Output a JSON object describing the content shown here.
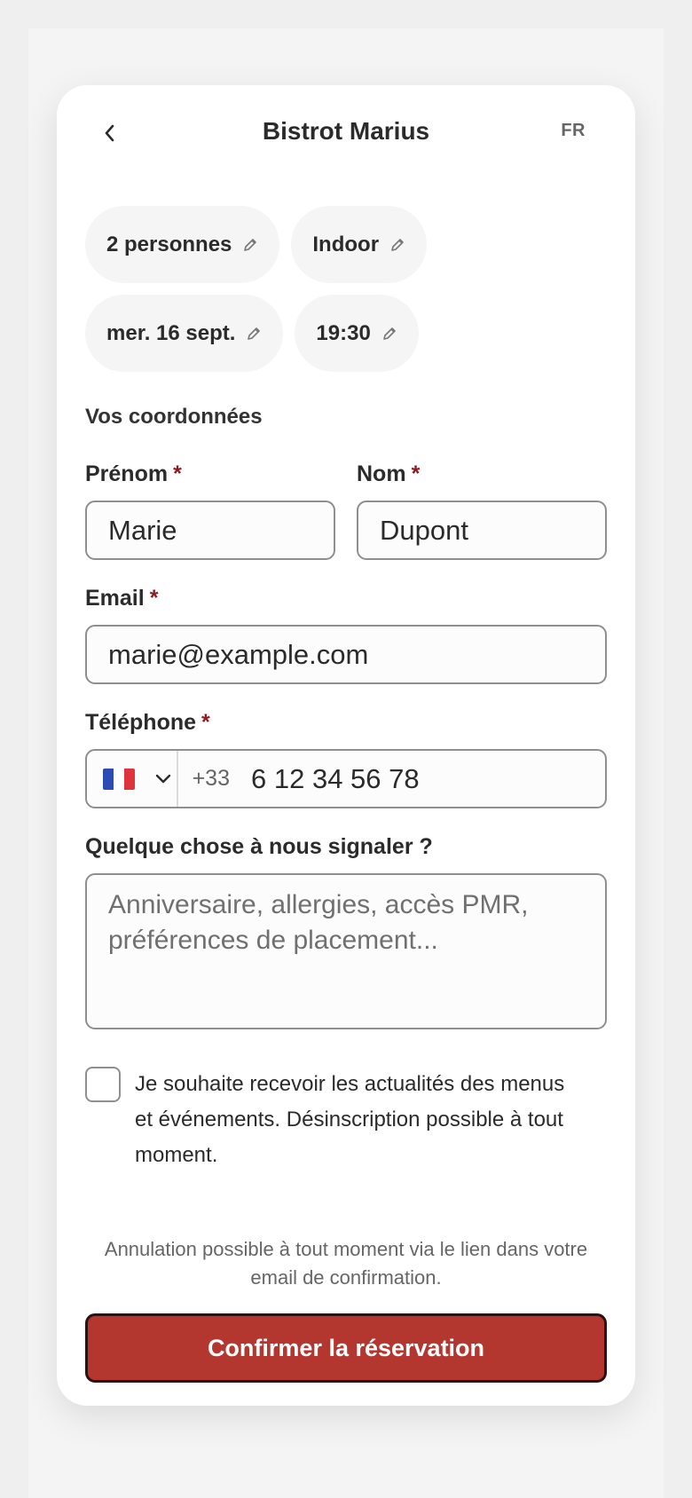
{
  "header": {
    "title": "Bistrot Marius",
    "lang": "FR"
  },
  "chips": [
    {
      "label": "2 personnes"
    },
    {
      "label": "Indoor"
    },
    {
      "label": "mer. 16 sept."
    },
    {
      "label": "19:30"
    }
  ],
  "form": {
    "section_title": "Vos coordonnées",
    "required_mark": "*",
    "first_name": {
      "label": "Prénom",
      "value": "Marie"
    },
    "last_name": {
      "label": "Nom",
      "value": "Dupont"
    },
    "email": {
      "label": "Email",
      "value": "marie@example.com"
    },
    "phone": {
      "label": "Téléphone",
      "dial_code": "+33",
      "value": "6 12 34 56 78",
      "country_flag": "fr-flag-icon"
    },
    "notes": {
      "label": "Quelque chose à nous signaler ?",
      "placeholder": "Anniversaire, allergies, accès PMR, préférences de placement..."
    },
    "newsletter": {
      "label": "Je souhaite recevoir les actualités des menus et événements. Désinscription possible à tout moment.",
      "checked": false
    }
  },
  "footer": {
    "note": "Annulation possible à tout moment via le lien dans votre email de confirmation.",
    "confirm_label": "Confirmer la réservation"
  },
  "colors": {
    "accent": "#b3372f",
    "required": "#8b1a22",
    "chip_bg": "#f5f5f5"
  }
}
